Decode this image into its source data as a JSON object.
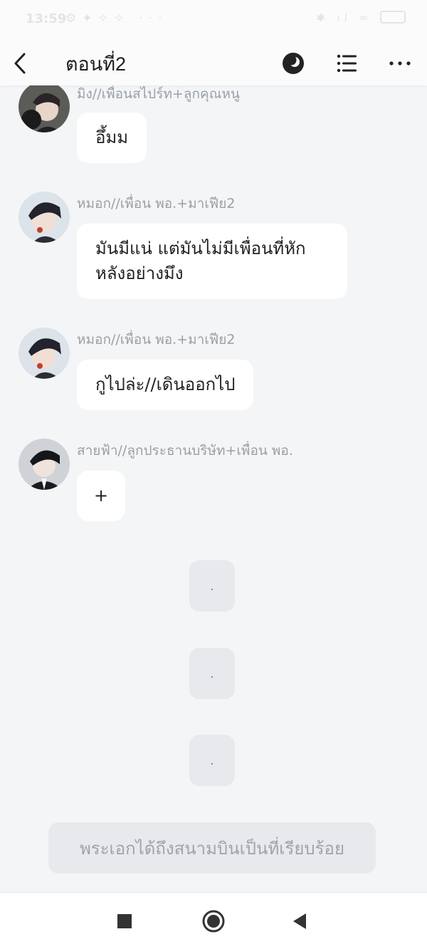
{
  "status": {
    "time": "13:59"
  },
  "header": {
    "title": "ตอนที่2"
  },
  "messages": [
    {
      "sender": "มิง//เพื่อนสไปร์ท+ลูกคุณหนู",
      "text": "อึ้มม",
      "avatar_icon": "avatar-dark-hair-cat"
    },
    {
      "sender": "หมอก//เพื่อน พอ.+มาเฟีย2",
      "text": "มันมีแน่ แต่มันไม่มีเพื่อนที่หัก\nหลังอย่างมึง",
      "avatar_icon": "avatar-dark-hair"
    },
    {
      "sender": "หมอก//เพื่อน พอ.+มาเฟีย2",
      "text": "กูไปล่ะ//เดินออกไป",
      "avatar_icon": "avatar-dark-hair"
    },
    {
      "sender": "สายฟ้า//ลูกประธานบริษัท+เพื่อน พอ.",
      "text": "+",
      "avatar_icon": "avatar-dark-hair-suit"
    }
  ],
  "narration": [
    ".",
    ".",
    "."
  ],
  "bottom_button": {
    "label": "พระเอกได้ถึงสนามบินเป็นที่เรียบร้อย"
  },
  "colors": {
    "background": "#f4f5f7",
    "bubble": "#ffffff",
    "sender_text": "#9aa0a6",
    "narration_bubble": "#e8e9ec"
  }
}
